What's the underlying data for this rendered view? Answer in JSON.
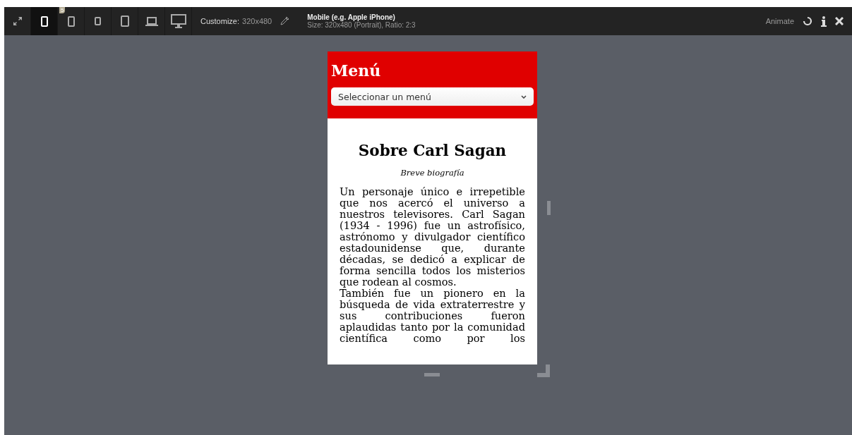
{
  "toolbar": {
    "devices": [
      {
        "kind": "phone",
        "selected": true
      },
      {
        "kind": "phone-wide",
        "selected": false,
        "badge": "5"
      },
      {
        "kind": "small-tablet",
        "selected": false
      },
      {
        "kind": "tablet",
        "selected": false
      },
      {
        "kind": "laptop",
        "selected": false
      },
      {
        "kind": "desktop",
        "selected": false
      }
    ],
    "customize_label": "Customize:",
    "customize_value": "320x480",
    "device_title": "Mobile (e.g. Apple iPhone)",
    "device_info": "Size: 320x480 (Portrait), Ratio: 2:3",
    "animate_label": "Animate"
  },
  "preview": {
    "menu_title": "Menú",
    "menu_select": {
      "value": "Seleccionar un menú"
    },
    "heading": "Sobre Carl Sagan",
    "subtitle": "Breve biografía",
    "paragraphs": [
      "Un personaje único e irrepetible que nos acercó el universo a nuestros televisores. Carl Sagan (1934 - 1996) fue un astrofísico, astrónomo y divulgador científico estadounidense que, durante décadas, se dedicó a explicar de forma sencilla todos los misterios que rodean al cosmos.",
      "También fue un pionero en la búsqueda de vida extraterrestre y sus contribuciones fueron aplaudidas tanto por la comunidad científica como por los"
    ]
  }
}
